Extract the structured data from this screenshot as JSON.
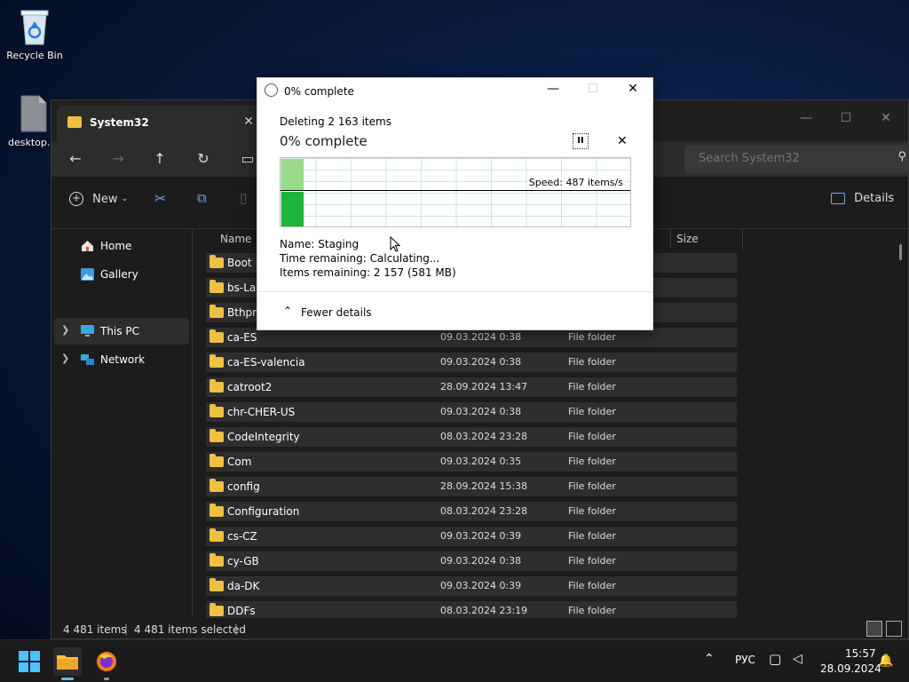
{
  "desktop": {
    "recycle_bin": "Recycle Bin",
    "desktop_ini": "desktop.i"
  },
  "explorer": {
    "tab_title": "System32",
    "search_placeholder": "Search System32",
    "toolbar": {
      "new_label": "New",
      "details_label": "Details"
    },
    "sidebar": [
      {
        "label": "Home",
        "icon": "home-icon"
      },
      {
        "label": "Gallery",
        "icon": "gallery-icon"
      },
      {
        "label": "This PC",
        "icon": "pc-icon",
        "active": true
      },
      {
        "label": "Network",
        "icon": "network-icon"
      }
    ],
    "columns": {
      "name": "Name",
      "size": "Size"
    },
    "rows": [
      {
        "name": "Boot",
        "date": "",
        "type": ""
      },
      {
        "name": "bs-Lat",
        "date": "",
        "type": ""
      },
      {
        "name": "Bthpro",
        "date": "",
        "type": ""
      },
      {
        "name": "ca-ES",
        "date": "09.03.2024 0:38",
        "type": "File folder"
      },
      {
        "name": "ca-ES-valencia",
        "date": "09.03.2024 0:38",
        "type": "File folder"
      },
      {
        "name": "catroot2",
        "date": "28.09.2024 13:47",
        "type": "File folder"
      },
      {
        "name": "chr-CHER-US",
        "date": "09.03.2024 0:38",
        "type": "File folder"
      },
      {
        "name": "CodeIntegrity",
        "date": "08.03.2024 23:28",
        "type": "File folder"
      },
      {
        "name": "Com",
        "date": "09.03.2024 0:35",
        "type": "File folder"
      },
      {
        "name": "config",
        "date": "28.09.2024 15:38",
        "type": "File folder"
      },
      {
        "name": "Configuration",
        "date": "08.03.2024 23:28",
        "type": "File folder"
      },
      {
        "name": "cs-CZ",
        "date": "09.03.2024 0:39",
        "type": "File folder"
      },
      {
        "name": "cy-GB",
        "date": "09.03.2024 0:38",
        "type": "File folder"
      },
      {
        "name": "da-DK",
        "date": "09.03.2024 0:39",
        "type": "File folder"
      },
      {
        "name": "DDFs",
        "date": "08.03.2024 23:19",
        "type": "File folder"
      }
    ],
    "status": {
      "items": "4 481 items",
      "selected": "4 481 items selected"
    }
  },
  "dialog": {
    "title": "0% complete",
    "subtitle": "Deleting 2 163 items",
    "heading": "0% complete",
    "speed": "Speed: 487 items/s",
    "name_line": "Name:  Staging",
    "time_line": "Time remaining:  Calculating...",
    "items_line": "Items remaining:  2 157 (581 MB)",
    "fewer_details": "Fewer details",
    "progress": 0
  },
  "taskbar": {
    "lang": "РУС",
    "time": "15:57",
    "date": "28.09.2024"
  }
}
